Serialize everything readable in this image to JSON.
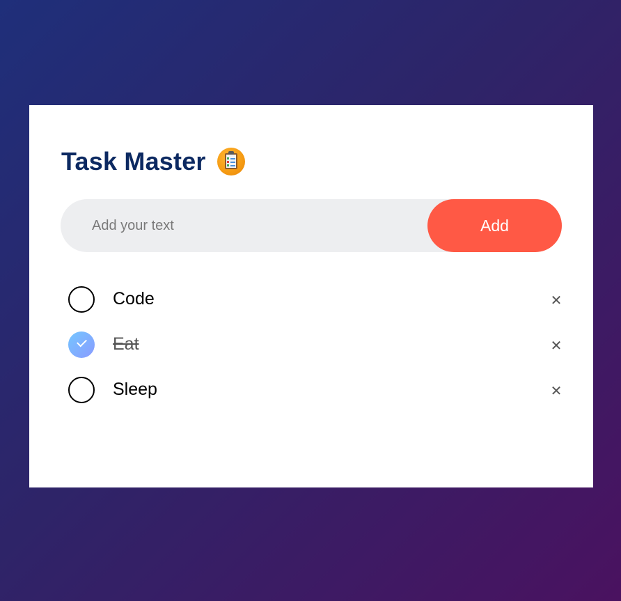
{
  "app": {
    "title": "Task Master",
    "logo_icon": "clipboard-checklist-icon"
  },
  "input": {
    "placeholder": "Add your text",
    "value": "",
    "add_label": "Add"
  },
  "tasks": [
    {
      "label": "Code",
      "completed": false,
      "delete_glyph": "✕"
    },
    {
      "label": "Eat",
      "completed": true,
      "delete_glyph": "✕"
    },
    {
      "label": "Sleep",
      "completed": false,
      "delete_glyph": "✕"
    }
  ],
  "colors": {
    "title": "#0c2961",
    "accent": "#ff5945",
    "check_gradient_start": "#74c6ff",
    "check_gradient_end": "#8a9bff",
    "input_background": "#edeef0"
  }
}
